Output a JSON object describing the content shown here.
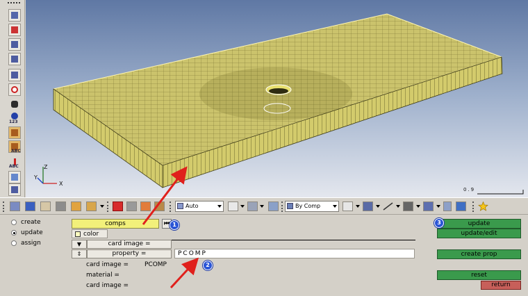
{
  "viewport": {
    "scale_label": "0.9",
    "axis_labels": {
      "z": "Z",
      "y": "Y",
      "x": "X"
    },
    "model_color": "#c9c16a"
  },
  "left_toolbar": {
    "text_labels": [
      "123",
      "ABC",
      "ABC"
    ]
  },
  "toolbar": {
    "display_mode": "Auto",
    "color_mode": "By Comp",
    "icons": [
      "components-icon",
      "shaded-icon",
      "mask-icon",
      "find-icon",
      "delete-icon",
      "transparency-icon",
      "visualization-icon",
      "view-icon",
      "star-icon"
    ]
  },
  "panel": {
    "radios": [
      {
        "label": "create",
        "selected": false
      },
      {
        "label": "update",
        "selected": true
      },
      {
        "label": "assign",
        "selected": false
      }
    ],
    "comps_label": "comps",
    "color_label": "color",
    "card_image_field": "card image =",
    "property_field": "property  =",
    "property_value": "PCOMP",
    "info_rows": [
      {
        "label": "card image =",
        "value": "PCOMP"
      },
      {
        "label": "material  =",
        "value": ""
      },
      {
        "label": "card image  =",
        "value": ""
      }
    ],
    "buttons": {
      "update": "update",
      "update_edit": "update/edit",
      "create_prop": "create prop",
      "reset": "reset",
      "return": "return"
    },
    "callouts": [
      "1",
      "2",
      "3"
    ]
  },
  "colors": {
    "green_button": "#3a9a4c",
    "red_button": "#c75f5a",
    "callout": "#2a55d6",
    "arrow": "#e0201c",
    "comps_yellow": "#f2f07a"
  }
}
